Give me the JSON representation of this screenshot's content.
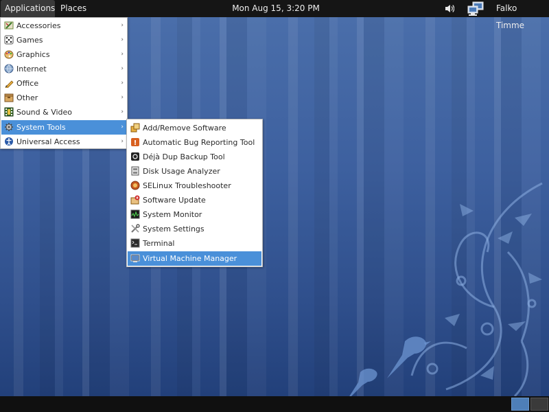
{
  "top_panel": {
    "applications_label": "Applications",
    "places_label": "Places",
    "clock": "Mon Aug 15,  3:20 PM",
    "user_name": "Falko Timme"
  },
  "applications_menu": {
    "items": [
      {
        "label": "Accessories",
        "icon": "accessories-icon"
      },
      {
        "label": "Games",
        "icon": "games-icon"
      },
      {
        "label": "Graphics",
        "icon": "graphics-icon"
      },
      {
        "label": "Internet",
        "icon": "internet-icon"
      },
      {
        "label": "Office",
        "icon": "office-icon"
      },
      {
        "label": "Other",
        "icon": "other-icon"
      },
      {
        "label": "Sound & Video",
        "icon": "sound-video-icon"
      },
      {
        "label": "System Tools",
        "icon": "system-tools-icon",
        "highlighted": true
      },
      {
        "label": "Universal Access",
        "icon": "universal-access-icon"
      }
    ],
    "submenu_arrow": "›"
  },
  "system_tools_menu": {
    "items": [
      {
        "label": "Add/Remove Software",
        "icon": "add-remove-software-icon"
      },
      {
        "label": "Automatic Bug Reporting Tool",
        "icon": "bug-reporting-icon"
      },
      {
        "label": "Déjà Dup Backup Tool",
        "icon": "backup-icon"
      },
      {
        "label": "Disk Usage Analyzer",
        "icon": "disk-usage-icon"
      },
      {
        "label": "SELinux Troubleshooter",
        "icon": "selinux-icon"
      },
      {
        "label": "Software Update",
        "icon": "software-update-icon"
      },
      {
        "label": "System Monitor",
        "icon": "system-monitor-icon"
      },
      {
        "label": "System Settings",
        "icon": "system-settings-icon"
      },
      {
        "label": "Terminal",
        "icon": "terminal-icon"
      },
      {
        "label": "Virtual Machine Manager",
        "icon": "virtual-machine-icon",
        "highlighted": true
      }
    ]
  },
  "colors": {
    "panel_bg": "#151515",
    "menu_highlight": "#4a90d9",
    "wallpaper_blue": "#3d609f"
  }
}
